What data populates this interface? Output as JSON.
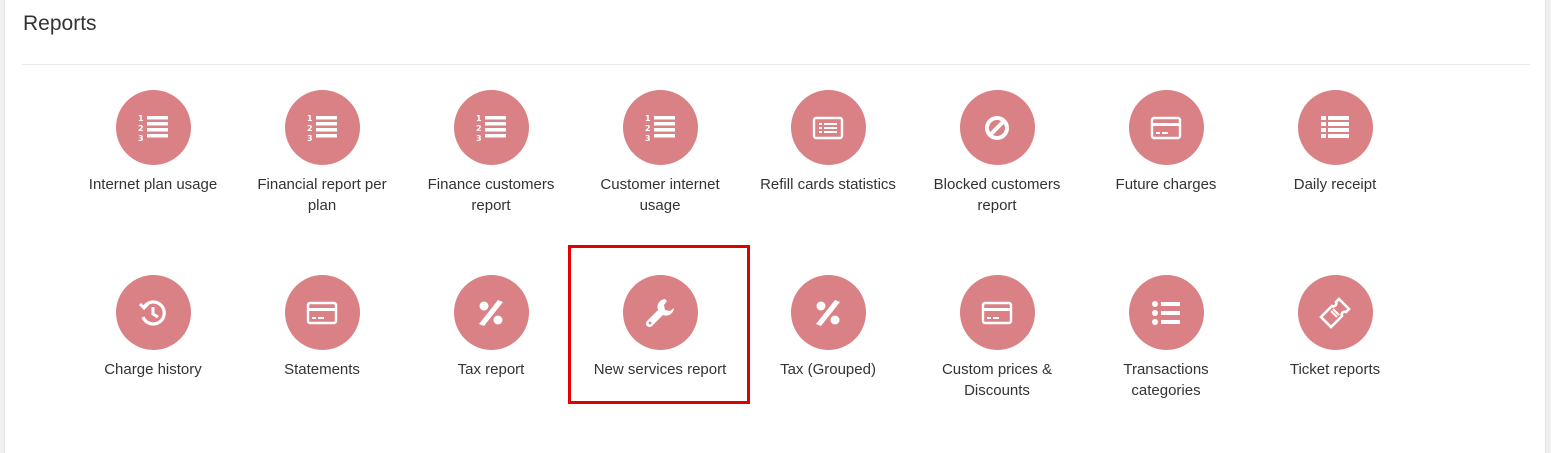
{
  "page": {
    "title": "Reports"
  },
  "colors": {
    "icon_circle": "#d98184",
    "highlight_border": "#e00000"
  },
  "reports": [
    {
      "label": "Internet plan usage",
      "icon": "numbered-list-icon"
    },
    {
      "label": "Financial report per plan",
      "icon": "numbered-list-icon"
    },
    {
      "label": "Finance customers report",
      "icon": "numbered-list-icon"
    },
    {
      "label": "Customer internet usage",
      "icon": "numbered-list-icon"
    },
    {
      "label": "Refill cards statistics",
      "icon": "card-list-icon"
    },
    {
      "label": "Blocked customers report",
      "icon": "blocked-icon"
    },
    {
      "label": "Future charges",
      "icon": "credit-card-icon"
    },
    {
      "label": "Daily receipt",
      "icon": "list-icon"
    },
    {
      "label": "Charge history",
      "icon": "history-icon"
    },
    {
      "label": "Statements",
      "icon": "credit-card-icon"
    },
    {
      "label": "Tax report",
      "icon": "percent-icon"
    },
    {
      "label": "New services report",
      "icon": "wrench-icon"
    },
    {
      "label": "Tax (Grouped)",
      "icon": "percent-icon"
    },
    {
      "label": "Custom prices & Discounts",
      "icon": "credit-card-icon"
    },
    {
      "label": "Transactions categories",
      "icon": "bullet-list-icon"
    },
    {
      "label": "Ticket reports",
      "icon": "ticket-icon"
    }
  ],
  "highlighted_report": "New services report"
}
